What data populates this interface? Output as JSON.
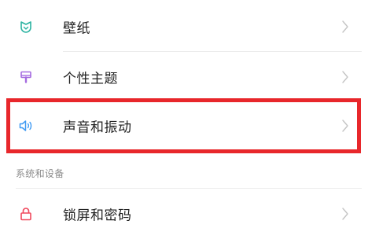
{
  "settings": {
    "items": [
      {
        "label": "壁纸",
        "icon": "wallpaper-icon",
        "icon_color": "#2bb3a1"
      },
      {
        "label": "个性主题",
        "icon": "theme-brush-icon",
        "icon_color": "#a56be0"
      },
      {
        "label": "声音和振动",
        "icon": "speaker-icon",
        "icon_color": "#3f9af3"
      }
    ],
    "section_title": "系统和设备",
    "section_items": [
      {
        "label": "锁屏和密码",
        "icon": "lock-icon",
        "icon_color": "#f04a5e"
      }
    ],
    "chevron_icon": "chevron-right-icon"
  },
  "highlight": {
    "color": "#e8272b",
    "target": "声音和振动"
  }
}
